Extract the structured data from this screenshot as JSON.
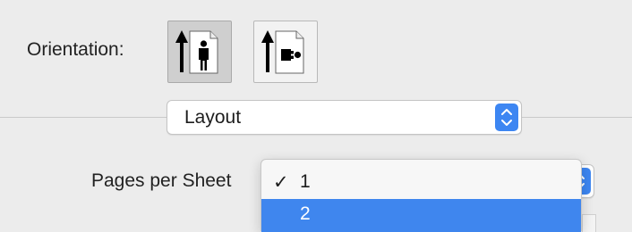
{
  "orientation": {
    "label": "Orientation:",
    "options": [
      {
        "name": "portrait",
        "selected": true,
        "icon": "portrait-orientation-icon"
      },
      {
        "name": "landscape",
        "selected": false,
        "icon": "landscape-orientation-icon"
      }
    ]
  },
  "section_popup": {
    "value": "Layout",
    "icon": "up-down-chevron-icon"
  },
  "pages_per_sheet": {
    "label": "Pages per Sheet",
    "menu_items": [
      {
        "label": "1",
        "checked": true,
        "check_mark": "✓",
        "highlighted": false
      },
      {
        "label": "2",
        "checked": false,
        "check_mark": "",
        "highlighted": true
      }
    ]
  },
  "colors": {
    "accent": "#3f86ee",
    "stepper": "#3d86f2",
    "background": "#ececec"
  }
}
